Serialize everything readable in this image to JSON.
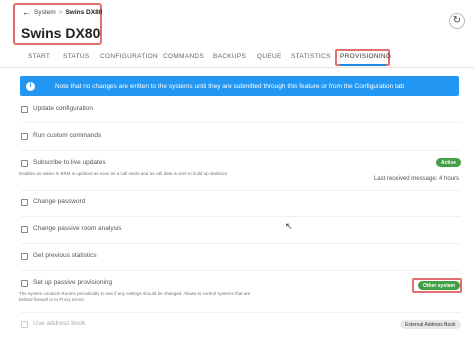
{
  "header": {
    "crumb_root": "System",
    "crumb_sep": ">",
    "crumb_current": "Swins DX80",
    "title": "Swins DX80"
  },
  "tabs": [
    {
      "label": "START"
    },
    {
      "label": "STATUS"
    },
    {
      "label": "CONFIGURATION"
    },
    {
      "label": "COMMANDS"
    },
    {
      "label": "BACKUPS"
    },
    {
      "label": "QUEUE"
    },
    {
      "label": "STATISTICS"
    },
    {
      "label": "PROVISIONING",
      "active": true
    }
  ],
  "info": {
    "icon": "info-icon",
    "text": "Note that no changes are written to the systems until they are submitted through this feature or from the Configuration tab"
  },
  "options": {
    "update_config": "Update configuration",
    "run_commands": "Run custom commands",
    "subscribe": "Subscribe to live updates",
    "subscribe_desc": "Enables as status in BRM is updated as soon as a call starts and as call data is sent to build up statistics",
    "subscribe_badge": "Active",
    "last_received": "Last received message: 4 hours",
    "change_password": "Change password",
    "passive_room": "Change passive room analysis",
    "previous_stats": "Get previous statistics",
    "passive_prov": "Set up passive provisioning",
    "passive_prov_desc": "The system contacts Rooms periodically to see if any settings should be changed. Allows to control systems that are behind firewall or to Proxy errors.",
    "passive_prov_badge": "Other system",
    "address_book": "Use address book",
    "address_book_badge": "External Address Book"
  },
  "colors": {
    "accent": "#2196f3",
    "tab_underline": "#1e88e5",
    "highlight": "#e0716f",
    "badge_green": "#43a047"
  }
}
